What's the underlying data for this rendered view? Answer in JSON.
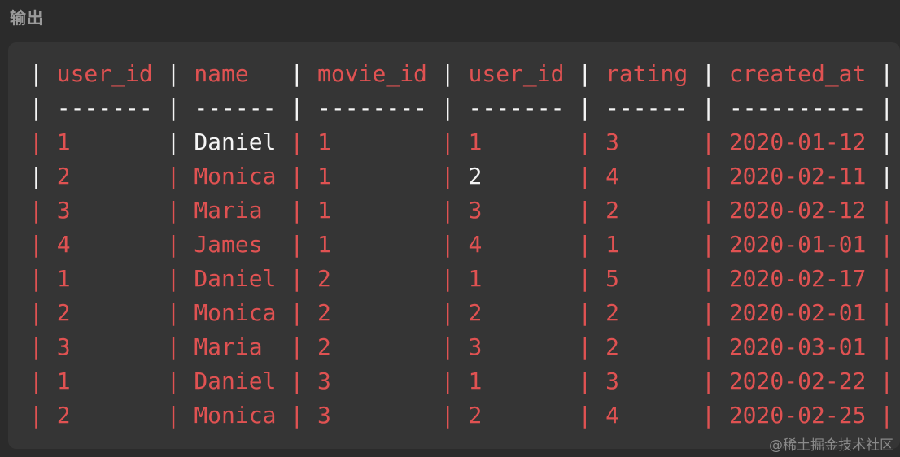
{
  "section_label": "输出",
  "watermark": "@稀土掘金技术社区",
  "colors": {
    "accent_red": "#e05252",
    "bright": "#f5f5f5",
    "panel_bg": "#353535",
    "page_bg": "#2b2b2b"
  },
  "table": {
    "columns": [
      "user_id",
      "name",
      "movie_id",
      "user_id",
      "rating",
      "created_at"
    ],
    "header_pipe_color": "bright",
    "separator_row": [
      "-------",
      "------",
      "--------",
      "-------",
      "------",
      "----------"
    ],
    "rows": [
      [
        "1",
        "Daniel",
        "1",
        "1",
        "3",
        "2020-01-12"
      ],
      [
        "2",
        "Monica",
        "1",
        "2",
        "4",
        "2020-02-11"
      ],
      [
        "3",
        "Maria",
        "1",
        "3",
        "2",
        "2020-02-12"
      ],
      [
        "4",
        "James",
        "1",
        "4",
        "1",
        "2020-01-01"
      ],
      [
        "1",
        "Daniel",
        "2",
        "1",
        "5",
        "2020-02-17"
      ],
      [
        "2",
        "Monica",
        "2",
        "2",
        "2",
        "2020-02-01"
      ],
      [
        "3",
        "Maria",
        "2",
        "3",
        "2",
        "2020-03-01"
      ],
      [
        "1",
        "Daniel",
        "3",
        "1",
        "3",
        "2020-02-22"
      ],
      [
        "2",
        "Monica",
        "3",
        "2",
        "4",
        "2020-02-25"
      ]
    ],
    "bright_cells": [
      {
        "row": 0,
        "col": 1
      },
      {
        "row": 1,
        "col": 3
      }
    ]
  }
}
